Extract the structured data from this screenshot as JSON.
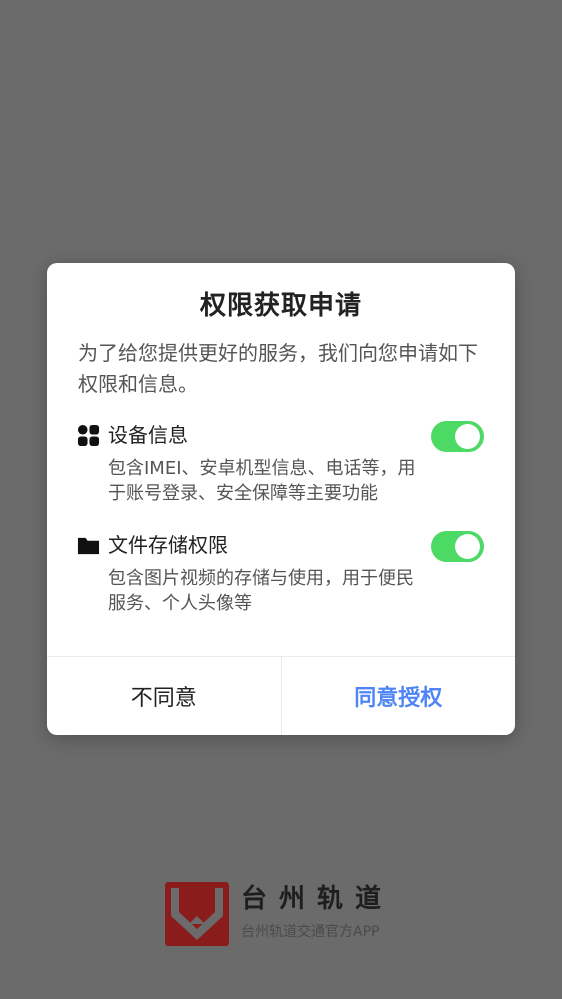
{
  "dialog": {
    "title": "权限获取申请",
    "intro": "为了给您提供更好的服务，我们向您申请如下权限和信息。",
    "permissions": [
      {
        "icon": "apps-grid-icon",
        "title": "设备信息",
        "description": "包含IMEI、安卓机型信息、电话等，用于账号登录、安全保障等主要功能",
        "enabled": true
      },
      {
        "icon": "folder-icon",
        "title": "文件存储权限",
        "description": "包含图片视频的存储与使用，用于便民服务、个人头像等",
        "enabled": true
      }
    ],
    "disagree_label": "不同意",
    "agree_label": "同意授权"
  },
  "brand": {
    "name": "台州轨道",
    "subtitle": "台州轨道交通官方APP"
  },
  "colors": {
    "overlay": "#6b6b6b",
    "toggle_on": "#4cd964",
    "agree": "#4f86f7",
    "logo": "#8a1c1c"
  }
}
